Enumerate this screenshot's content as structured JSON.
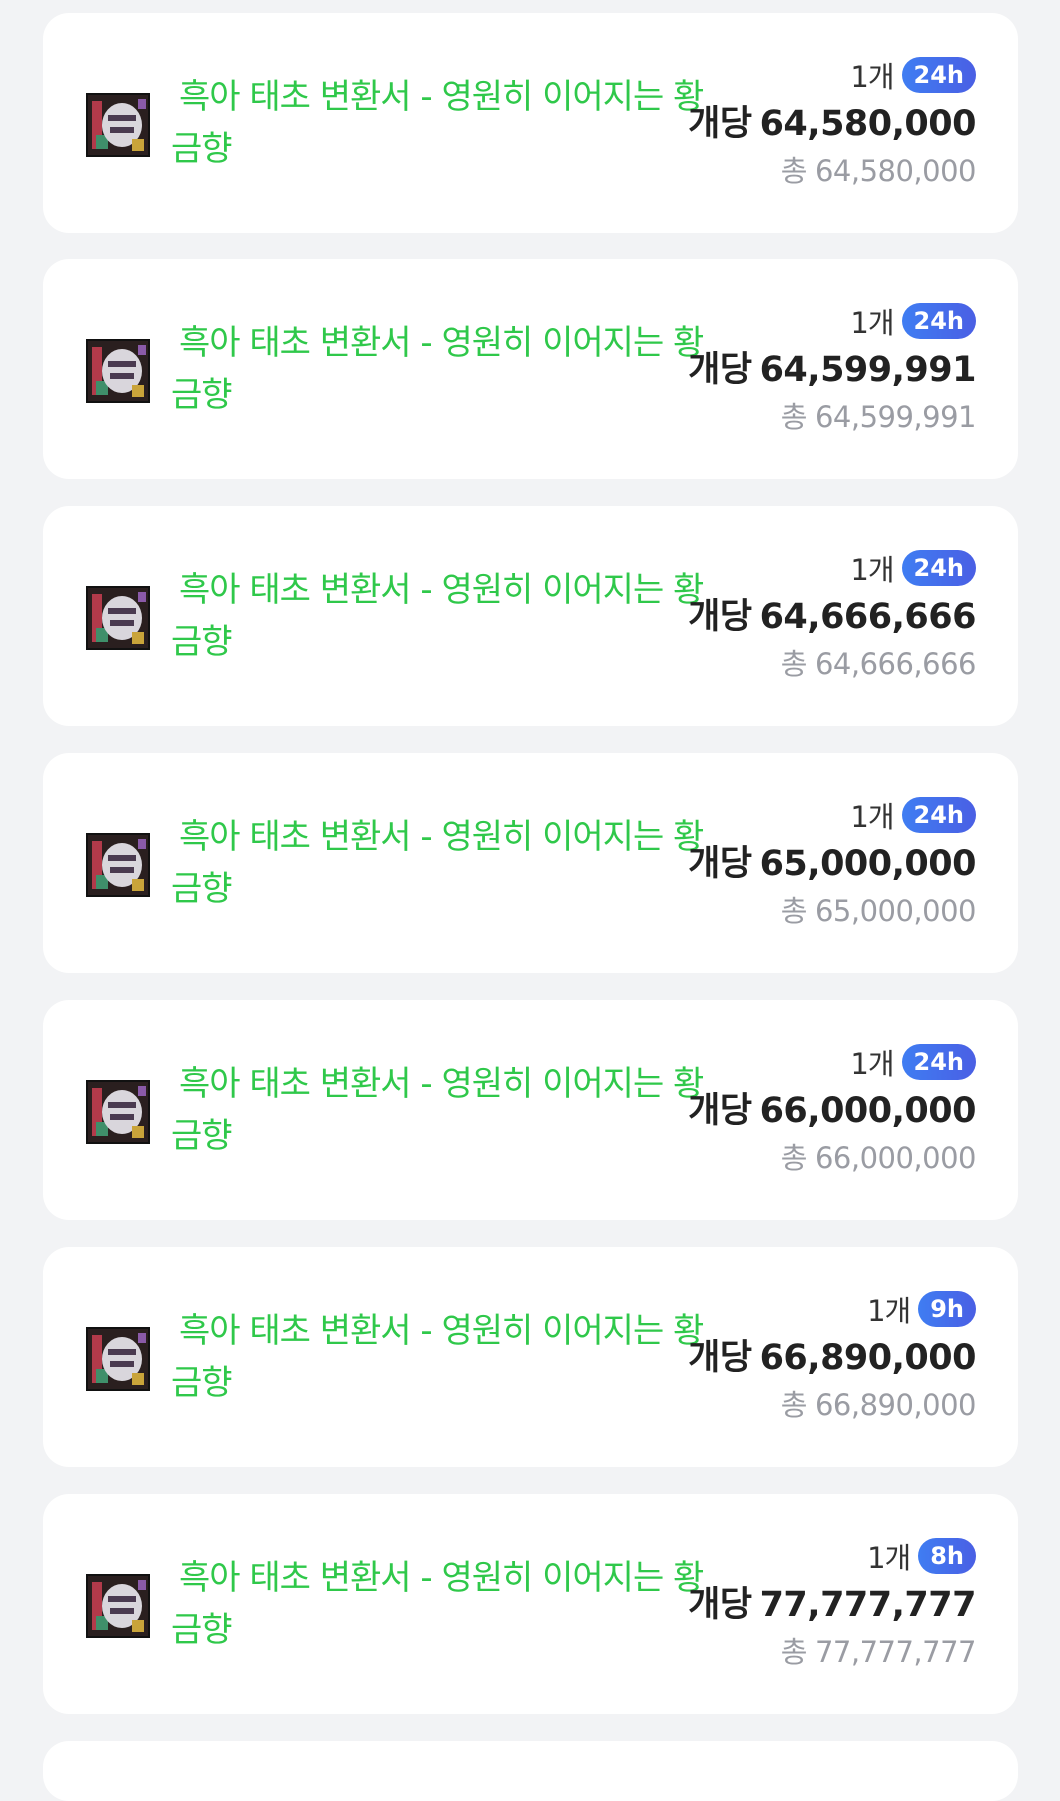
{
  "listings": [
    {
      "name": "흑아 태초 변환서 - 영원히 이어지는 황금향",
      "qty": "1개",
      "time": "24h",
      "unit_label": "개당",
      "unit_price": "64,580,000",
      "total_label": "총",
      "total_price": "64,580,000"
    },
    {
      "name": "흑아 태초 변환서 - 영원히 이어지는 황금향",
      "qty": "1개",
      "time": "24h",
      "unit_label": "개당",
      "unit_price": "64,599,991",
      "total_label": "총",
      "total_price": "64,599,991"
    },
    {
      "name": "흑아 태초 변환서 - 영원히 이어지는 황금향",
      "qty": "1개",
      "time": "24h",
      "unit_label": "개당",
      "unit_price": "64,666,666",
      "total_label": "총",
      "total_price": "64,666,666"
    },
    {
      "name": "흑아 태초 변환서 - 영원히 이어지는 황금향",
      "qty": "1개",
      "time": "24h",
      "unit_label": "개당",
      "unit_price": "65,000,000",
      "total_label": "총",
      "total_price": "65,000,000"
    },
    {
      "name": "흑아 태초 변환서 - 영원히 이어지는 황금향",
      "qty": "1개",
      "time": "24h",
      "unit_label": "개당",
      "unit_price": "66,000,000",
      "total_label": "총",
      "total_price": "66,000,000"
    },
    {
      "name": "흑아 태초 변환서 - 영원히 이어지는 황금향",
      "qty": "1개",
      "time": "9h",
      "unit_label": "개당",
      "unit_price": "66,890,000",
      "total_label": "총",
      "total_price": "66,890,000"
    },
    {
      "name": "흑아 태초 변환서 - 영원히 이어지는 황금향",
      "qty": "1개",
      "time": "8h",
      "unit_label": "개당",
      "unit_price": "77,777,777",
      "total_label": "총",
      "total_price": "77,777,777"
    }
  ],
  "item_icon": "scroll-item-icon",
  "colors": {
    "item_name": "#2fc84a",
    "badge_start": "#3f7df2",
    "badge_end": "#4a5fe4",
    "background": "#f2f3f5"
  }
}
